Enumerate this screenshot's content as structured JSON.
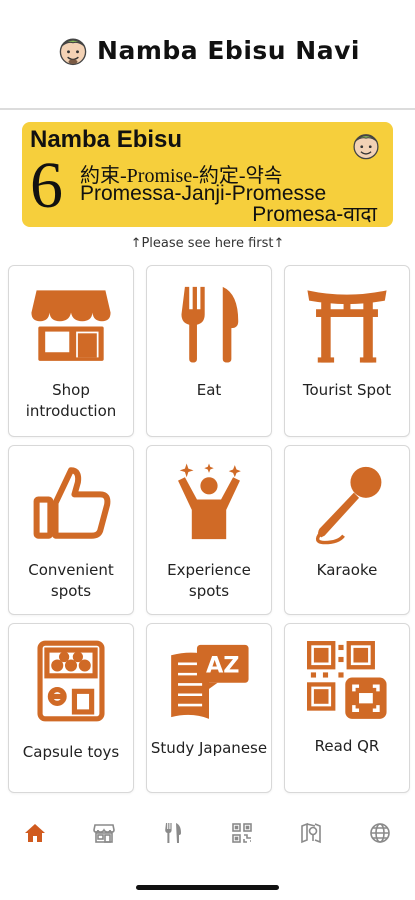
{
  "header": {
    "title": "Namba Ebisu Navi",
    "mascot_icon": "ebisu-mascot-icon"
  },
  "banner": {
    "line_title": "Namba Ebisu",
    "number": "6",
    "line1": "約束-Promise-約定-약속",
    "line2": "Promessa-Janji-Promesse",
    "line3": "Promesa-वादा"
  },
  "hint": "↑Please see here first↑",
  "menu": [
    {
      "label": "Shop introduction",
      "icon": "storefront-icon"
    },
    {
      "label": "Eat",
      "icon": "fork-knife-icon"
    },
    {
      "label": "Tourist Spot",
      "icon": "torii-gate-icon"
    },
    {
      "label": "Convenient spots",
      "icon": "thumbs-up-icon"
    },
    {
      "label": "Experience spots",
      "icon": "celebrating-person-icon"
    },
    {
      "label": "Karaoke",
      "icon": "microphone-icon"
    },
    {
      "label": "Capsule toys",
      "icon": "capsule-machine-icon"
    },
    {
      "label": "Study Japanese",
      "icon": "book-az-icon"
    },
    {
      "label": "Read QR",
      "icon": "qr-code-icon"
    }
  ],
  "tabbar": [
    {
      "icon": "home-icon",
      "active": true
    },
    {
      "icon": "storefront-icon"
    },
    {
      "icon": "fork-knife-icon"
    },
    {
      "icon": "qr-code-icon"
    },
    {
      "icon": "map-pin-icon"
    },
    {
      "icon": "globe-icon"
    }
  ],
  "colors": {
    "accent": "#d06a26",
    "banner": "#f6cf3c",
    "active_tab": "#d05a1e",
    "inactive_tab": "#8a8a8a"
  }
}
